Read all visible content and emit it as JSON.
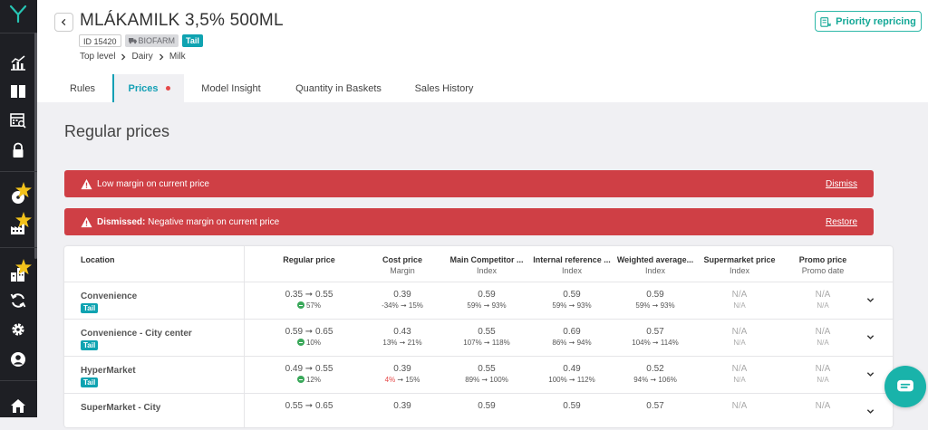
{
  "product": {
    "title": "MLÁKAMILK 3,5% 500ML",
    "id_label": "ID 15420",
    "supplier": "BIOFARM",
    "tag": "Tail",
    "breadcrumbs": [
      "Top level",
      "Dairy",
      "Milk"
    ]
  },
  "header": {
    "priority_button": "Priority repricing"
  },
  "tabs": [
    {
      "label": "Rules"
    },
    {
      "label": "Prices"
    },
    {
      "label": "Model Insight"
    },
    {
      "label": "Quantity in Baskets"
    },
    {
      "label": "Sales History"
    }
  ],
  "section_title": "Regular prices",
  "alerts": [
    {
      "prefix": "",
      "text": "Low margin on current price",
      "action": "Dismiss"
    },
    {
      "prefix": "Dismissed:",
      "text": " Negative margin on current price",
      "action": "Restore"
    }
  ],
  "table": {
    "headers": [
      {
        "title": "Location",
        "sub": ""
      },
      {
        "title": "Regular price",
        "sub": ""
      },
      {
        "title": "Cost price",
        "sub": "Margin"
      },
      {
        "title": "Main Competitor ...",
        "sub": "Index"
      },
      {
        "title": "Internal reference ...",
        "sub": "Index"
      },
      {
        "title": "Weighted average...",
        "sub": "Index"
      },
      {
        "title": "Supermarket price",
        "sub": "Index"
      },
      {
        "title": "Promo price",
        "sub": "Promo date"
      }
    ],
    "rows": [
      {
        "location": "Convenience",
        "tag": "Tail",
        "regular": "0.35 ➞ 0.55",
        "regular_sub": "57%",
        "cost": "0.39",
        "cost_sub_a": "-34%",
        "cost_sub_b": " ➞ 15%",
        "cost_red": false,
        "comp": "0.59",
        "comp_sub": "59% ➞ 93%",
        "internal": "0.59",
        "internal_sub": "59% ➞ 93%",
        "weighted": "0.59",
        "weighted_sub": "59% ➞ 93%",
        "super": "N/A",
        "super_sub": "N/A",
        "promo": "N/A",
        "promo_sub": "N/A"
      },
      {
        "location": "Convenience - City center",
        "tag": "Tail",
        "regular": "0.59 ➞ 0.65",
        "regular_sub": "10%",
        "cost": "0.43",
        "cost_sub_a": "13%",
        "cost_sub_b": " ➞ 21%",
        "cost_red": false,
        "comp": "0.55",
        "comp_sub": "107% ➞ 118%",
        "internal": "0.69",
        "internal_sub": "86% ➞ 94%",
        "weighted": "0.57",
        "weighted_sub": "104% ➞ 114%",
        "super": "N/A",
        "super_sub": "N/A",
        "promo": "N/A",
        "promo_sub": "N/A"
      },
      {
        "location": "HyperMarket",
        "tag": "Tail",
        "regular": "0.49 ➞ 0.55",
        "regular_sub": "12%",
        "cost": "0.39",
        "cost_sub_a": "4%",
        "cost_sub_b": " ➞ 15%",
        "cost_red": true,
        "comp": "0.55",
        "comp_sub": "89% ➞ 100%",
        "internal": "0.49",
        "internal_sub": "100% ➞ 112%",
        "weighted": "0.52",
        "weighted_sub": "94% ➞ 106%",
        "super": "N/A",
        "super_sub": "N/A",
        "promo": "N/A",
        "promo_sub": "N/A"
      },
      {
        "location": "SuperMarket - City",
        "tag": "",
        "regular": "0.55 ➞ 0.65",
        "regular_sub": "",
        "cost": "0.39",
        "cost_sub_a": "",
        "cost_sub_b": "",
        "cost_red": false,
        "comp": "0.59",
        "comp_sub": "",
        "internal": "0.59",
        "internal_sub": "",
        "weighted": "0.57",
        "weighted_sub": "",
        "super": "N/A",
        "super_sub": "",
        "promo": "N/A",
        "promo_sub": ""
      }
    ]
  },
  "colors": {
    "accent": "#14a0b5",
    "alert": "#cf3f45",
    "sidebar": "#1e1f24",
    "teal": "#19b3aa"
  },
  "icons": [
    "logo-icon",
    "dashboard-icon",
    "columns-icon",
    "calendar-search-icon",
    "lock-icon",
    "gauge-icon",
    "factory-icon",
    "buildings-icon",
    "refresh-icon",
    "settings-icon",
    "user-icon",
    "home-icon",
    "chat-icon"
  ]
}
